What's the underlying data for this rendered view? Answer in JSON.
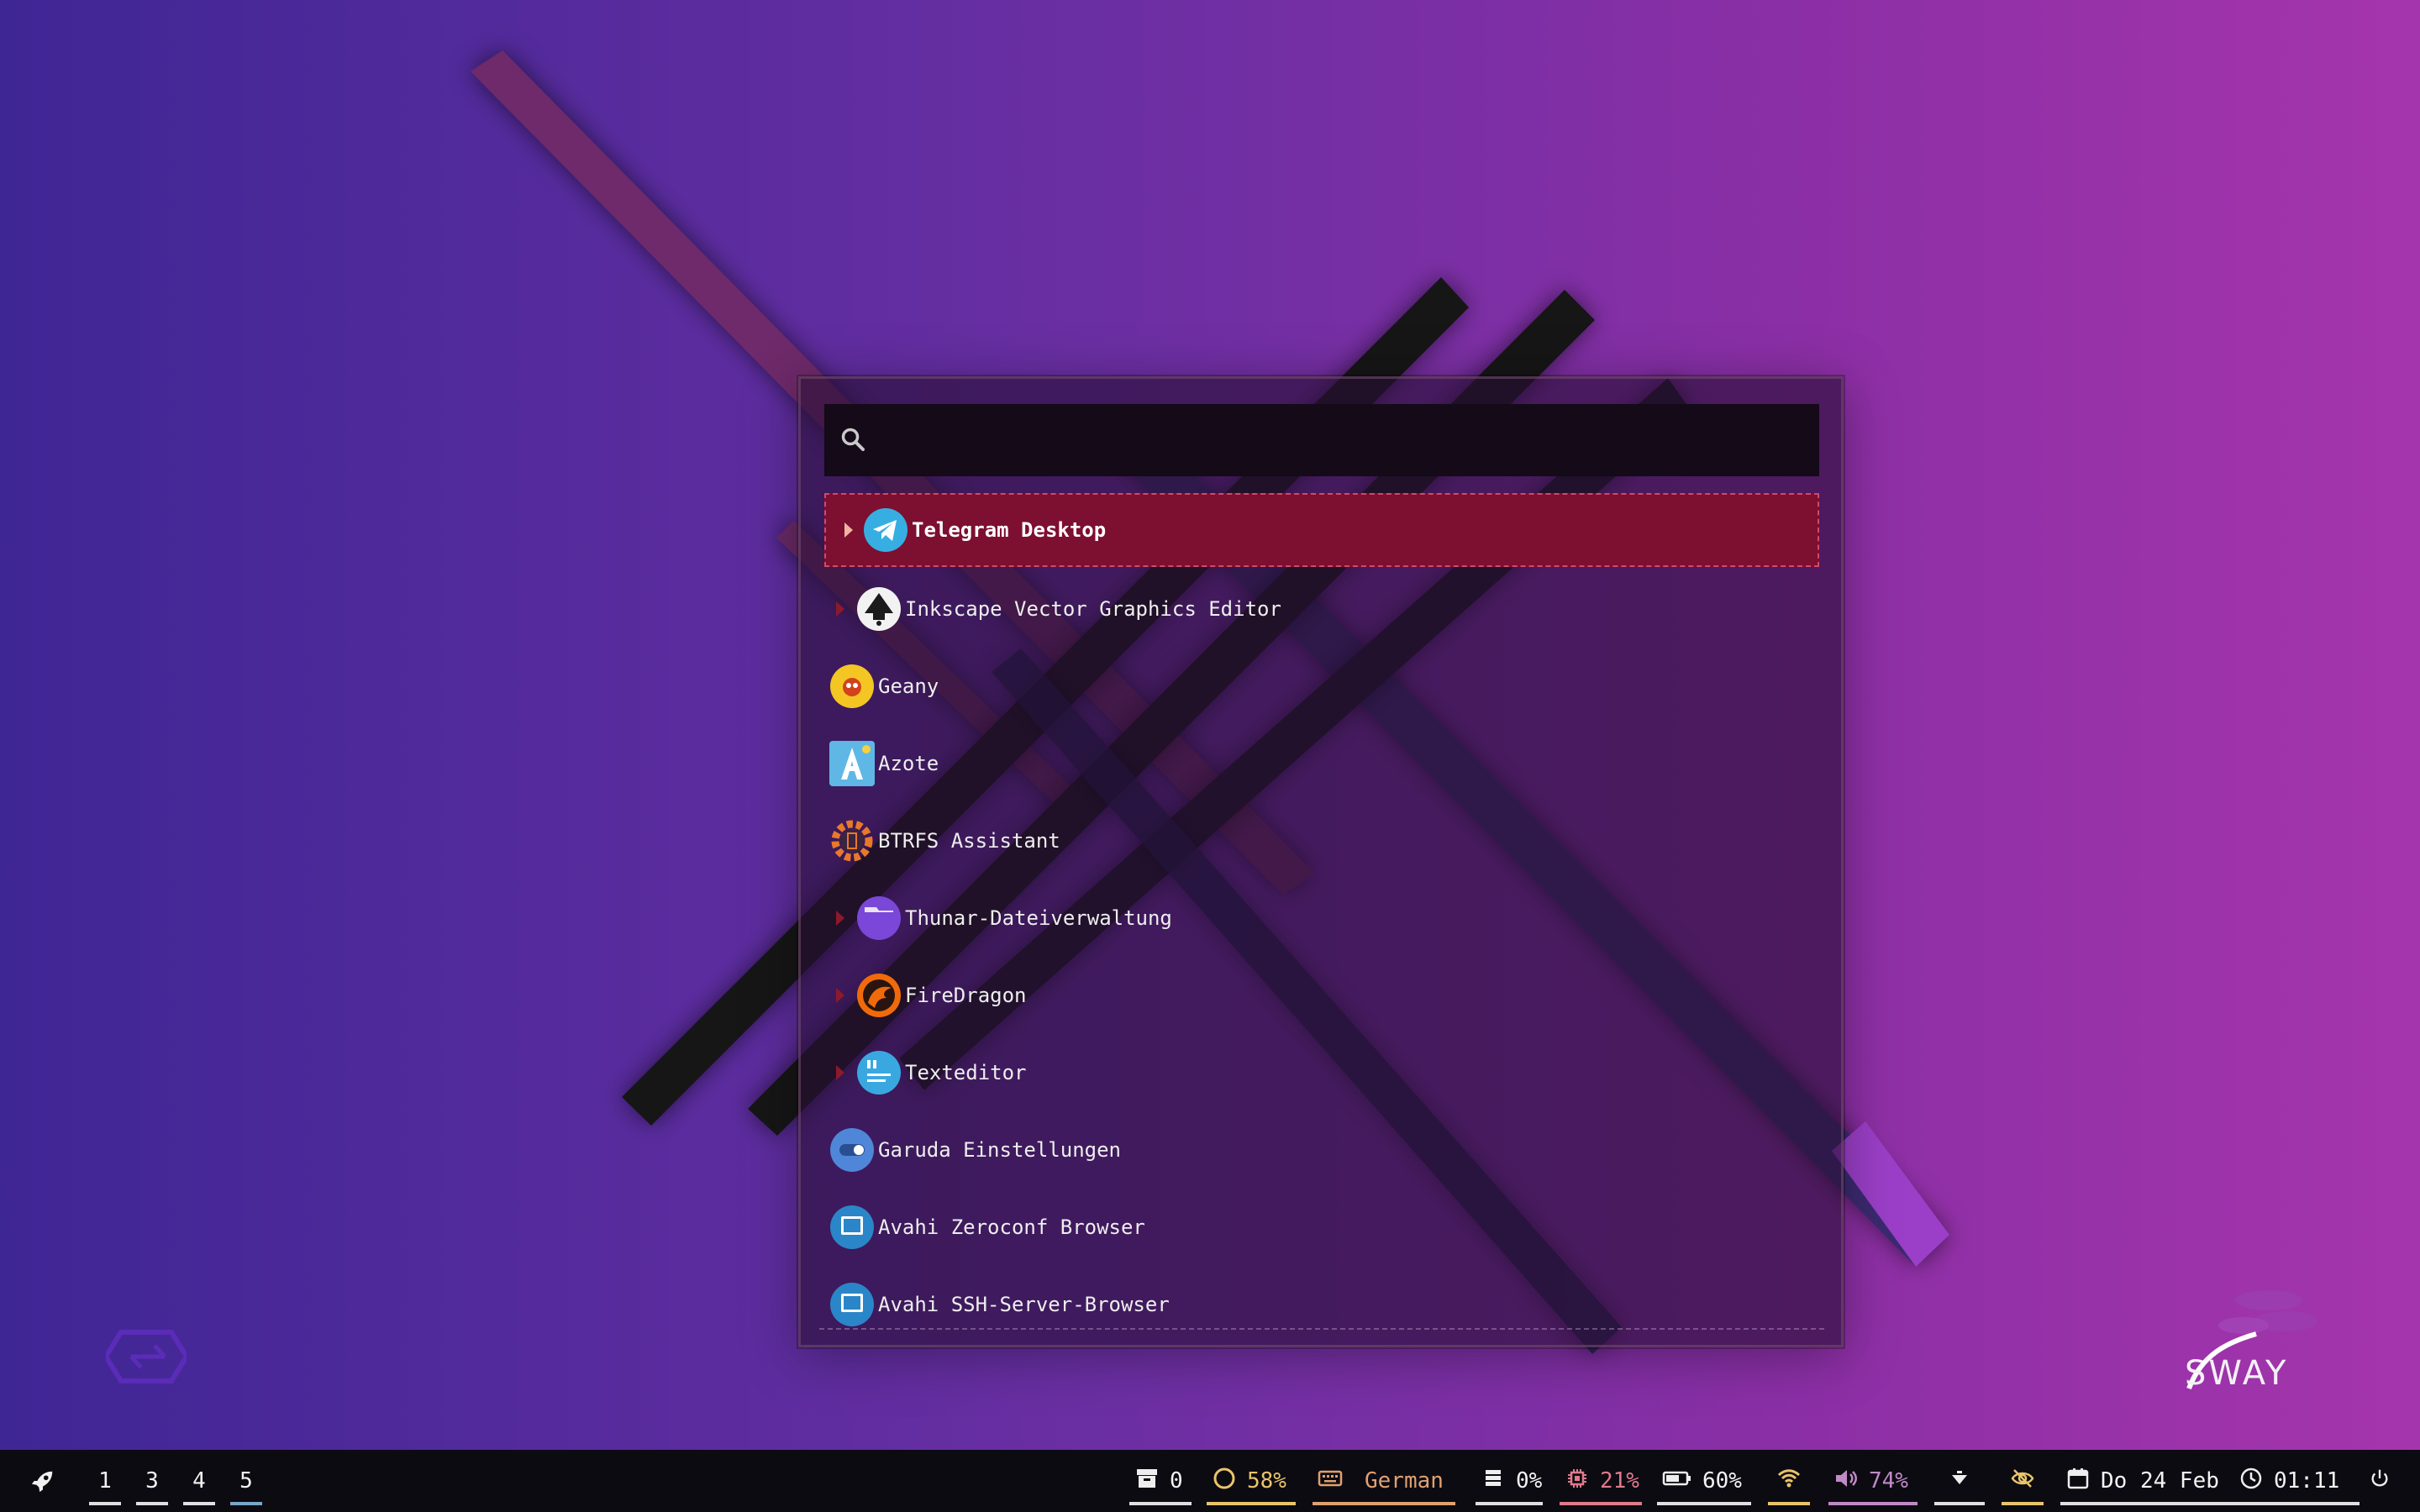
{
  "launcher": {
    "search": {
      "value": "",
      "placeholder": ""
    },
    "items": [
      {
        "label": "Telegram Desktop",
        "icon": "telegram-icon",
        "selected": true,
        "expandable": true
      },
      {
        "label": "Inkscape Vector Graphics Editor",
        "icon": "inkscape-icon",
        "selected": false,
        "expandable": true
      },
      {
        "label": "Geany",
        "icon": "geany-icon",
        "selected": false,
        "expandable": false
      },
      {
        "label": "Azote",
        "icon": "azote-icon",
        "selected": false,
        "expandable": false
      },
      {
        "label": "BTRFS Assistant",
        "icon": "btrfs-assistant-icon",
        "selected": false,
        "expandable": false
      },
      {
        "label": "Thunar-Dateiverwaltung",
        "icon": "folder-icon",
        "selected": false,
        "expandable": true
      },
      {
        "label": "FireDragon",
        "icon": "firedragon-icon",
        "selected": false,
        "expandable": true
      },
      {
        "label": "Texteditor",
        "icon": "texteditor-icon",
        "selected": false,
        "expandable": true
      },
      {
        "label": "Garuda Einstellungen",
        "icon": "toggle-settings-icon",
        "selected": false,
        "expandable": false
      },
      {
        "label": "Avahi Zeroconf Browser",
        "icon": "network-icon",
        "selected": false,
        "expandable": false
      },
      {
        "label": "Avahi SSH-Server-Browser",
        "icon": "network-icon",
        "selected": false,
        "expandable": false
      }
    ]
  },
  "wallpaper": {
    "logo_text": "SWAY"
  },
  "taskbar": {
    "launcher_icon": "rocket-icon",
    "workspaces": [
      "1",
      "3",
      "4",
      "5"
    ],
    "active_workspace": "5",
    "archive_count": "0",
    "memory": "58%",
    "keyboard_layout": "German",
    "disk": "0%",
    "cpu": "21%",
    "battery": "60%",
    "volume": "74%",
    "date": "Do 24 Feb",
    "time": "01:11",
    "colors": {
      "accent_yellow": "#e9c46a",
      "accent_pink": "#e07a8c",
      "accent_orange": "#e0a070",
      "accent_purple": "#c08ac8",
      "selection_red": "#7d0f30"
    }
  }
}
